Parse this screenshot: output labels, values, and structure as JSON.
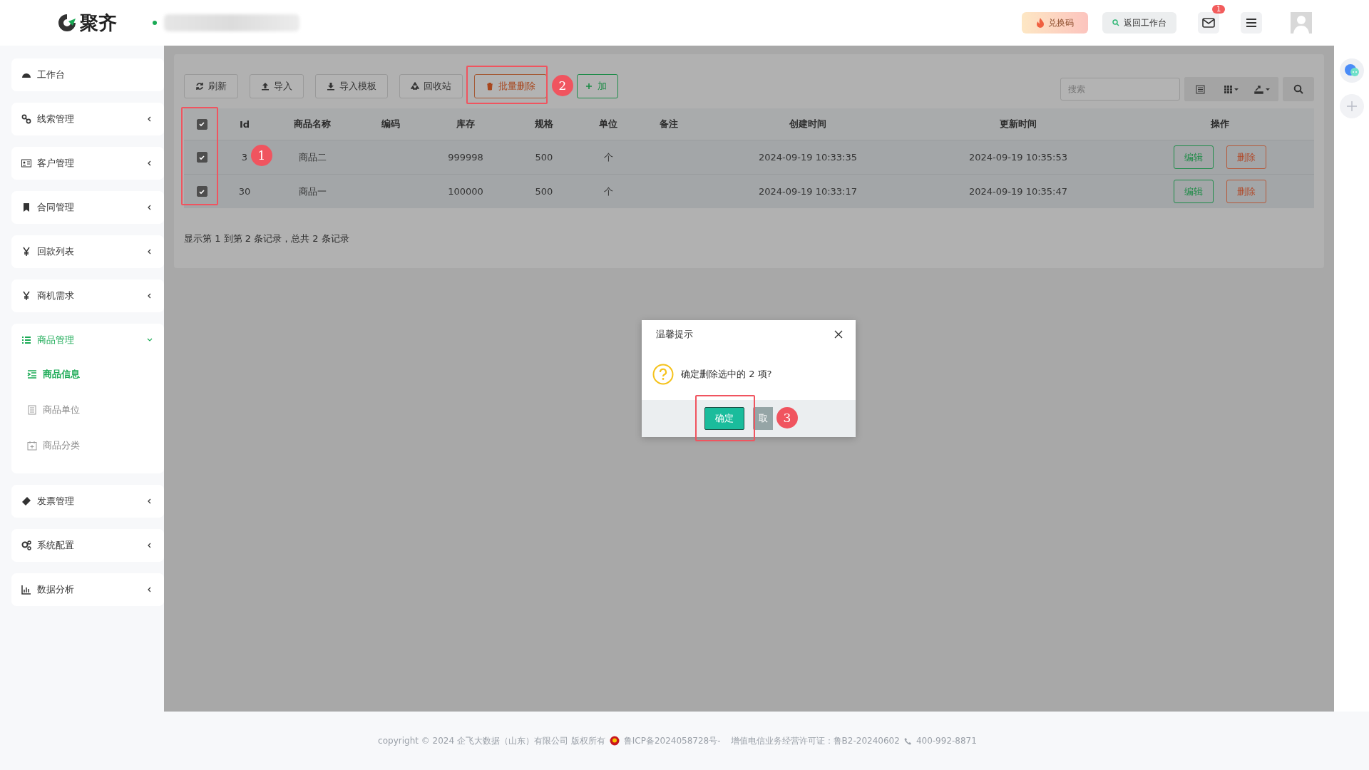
{
  "header": {
    "logo": "聚齐",
    "redeem_button": "兑换码",
    "back_button": "返回工作台",
    "mail_badge": "1"
  },
  "sidebar": {
    "items": [
      {
        "label": "工作台",
        "kind": "page",
        "selected": false
      },
      {
        "label": "线索管理",
        "kind": "group",
        "expanded": false,
        "selected": false
      },
      {
        "label": "客户管理",
        "kind": "group",
        "expanded": false,
        "selected": false
      },
      {
        "label": "合同管理",
        "kind": "group",
        "expanded": false,
        "selected": false
      },
      {
        "label": "回款列表",
        "kind": "group",
        "expanded": false,
        "selected": false
      },
      {
        "label": "商机需求",
        "kind": "group",
        "expanded": false,
        "selected": false
      },
      {
        "label": "商品管理",
        "kind": "group",
        "expanded": true,
        "selected": true,
        "children": [
          {
            "label": "商品信息",
            "selected": true
          },
          {
            "label": "商品单位",
            "selected": false
          },
          {
            "label": "商品分类",
            "selected": false
          }
        ]
      },
      {
        "label": "发票管理",
        "kind": "group",
        "expanded": false,
        "selected": false
      },
      {
        "label": "系统配置",
        "kind": "group",
        "expanded": false,
        "selected": false
      },
      {
        "label": "数据分析",
        "kind": "group",
        "expanded": false,
        "selected": false
      }
    ]
  },
  "toolbar": {
    "buttons": [
      {
        "label": "刷新",
        "kind": "refresh"
      },
      {
        "label": "导入",
        "kind": "upload"
      },
      {
        "label": "导入模板",
        "kind": "download"
      },
      {
        "label": "回收站",
        "kind": "recycle"
      },
      {
        "label": "批量删除",
        "kind": "danger"
      },
      {
        "label": "加",
        "kind": "add"
      }
    ],
    "search": {
      "placeholder": "搜索"
    }
  },
  "table": {
    "all_checked": true,
    "columns": [
      "Id",
      "商品名称",
      "编码",
      "库存",
      "规格",
      "单位",
      "备注",
      "创建时间",
      "更新时间",
      "操作"
    ],
    "rows": [
      {
        "checked": true,
        "cells": [
          "3",
          "商品二",
          "",
          "999998",
          "500",
          "个",
          "",
          "2024-09-19 10:33:35",
          "2024-09-19 10:35:53"
        ],
        "edit": "编辑",
        "delete": "删除"
      },
      {
        "checked": true,
        "cells": [
          "30",
          "商品一",
          "",
          "100000",
          "500",
          "个",
          "",
          "2024-09-19 10:33:17",
          "2024-09-19 10:35:47"
        ],
        "edit": "编辑",
        "delete": "删除"
      }
    ]
  },
  "pagination": "显示第 1 到第 2 条记录，总共 2 条记录",
  "dialog": {
    "title": "温馨提示",
    "message": "确定删除选中的 2 项?",
    "confirm": "确定",
    "cancel": "取"
  },
  "annotations": [
    {
      "label": "1"
    },
    {
      "label": "2"
    },
    {
      "label": "3"
    }
  ],
  "footer": {
    "copyright": "copyright © 2024 企飞大数据（山东）有限公司 版权所有",
    "icp": "鲁ICP备2024058728号-",
    "license": "增值电信业务经营许可证：鲁B2-20240602",
    "phone": "400-992-8871"
  }
}
